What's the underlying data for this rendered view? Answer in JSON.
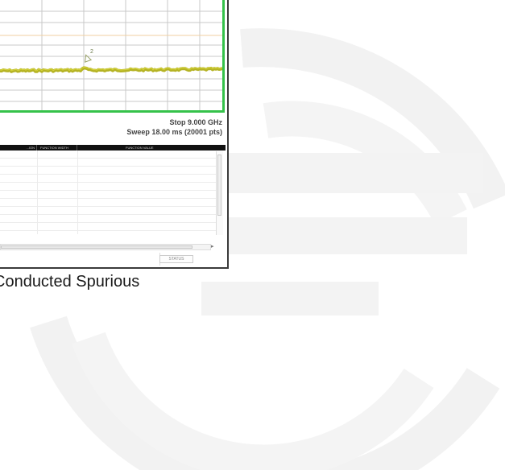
{
  "colors": {
    "trace": "#b5b324",
    "trace_highlight": "#d6d43a",
    "plot_border": "#35c24a",
    "limit_line": "#f0cfa0",
    "grid": "#c9c9c9",
    "table_header_bg": "#111111",
    "watermark": "#f2f2f2"
  },
  "icons": {
    "marker": "marker-icon",
    "scroll_arrow": "scroll-right-arrow-icon"
  },
  "analyzer": {
    "marker_label": "2",
    "stop_readout": "Stop 9.000 GHz",
    "sweep_readout": "Sweep  18.00 ms (20001 pts)"
  },
  "marker_table": {
    "columns": [
      "...ION",
      "FUNCTION WIDTH",
      "FUNCTION VALUE"
    ],
    "rows": 10
  },
  "status_bar": {
    "button_label": "STATUS"
  },
  "caption": "Conducted Spurious"
}
